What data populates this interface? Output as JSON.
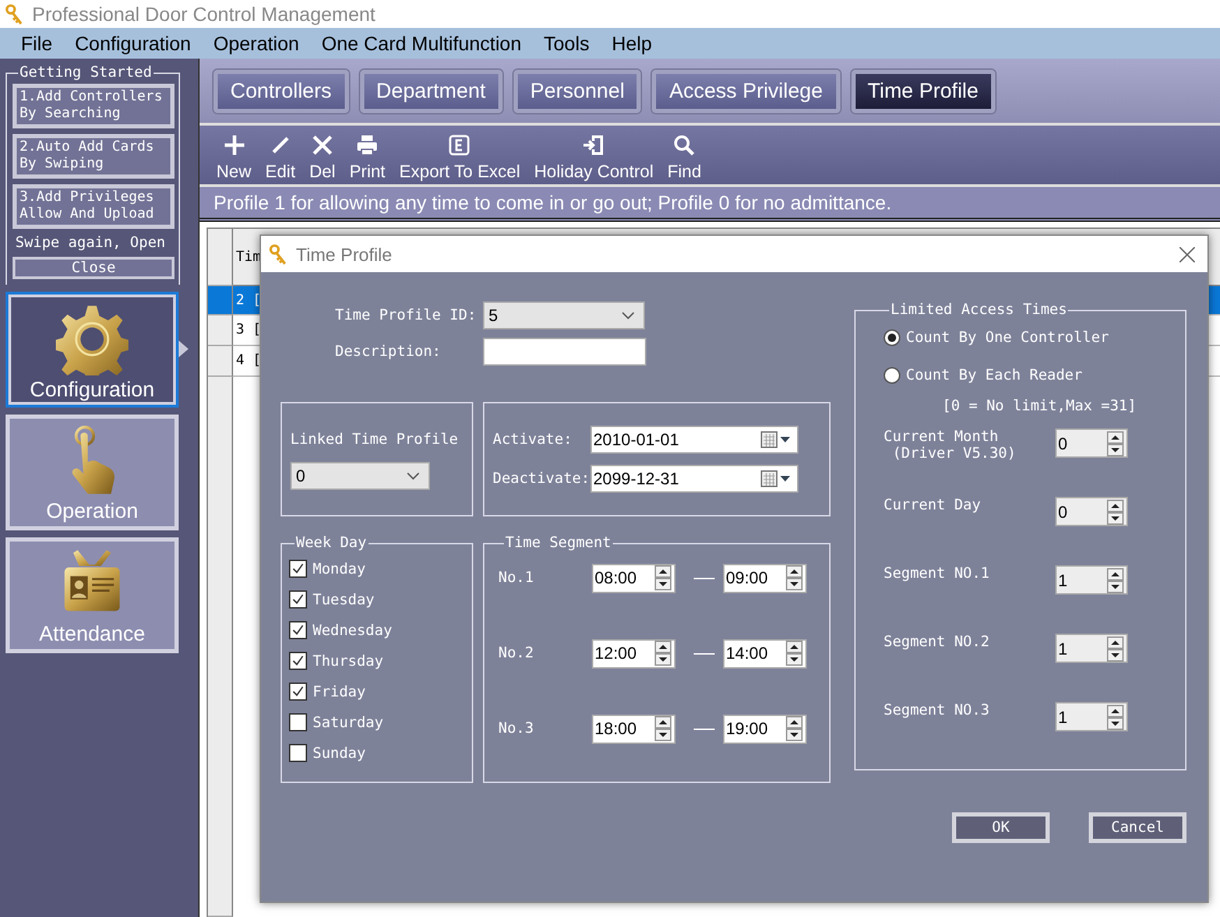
{
  "window": {
    "title": "Professional Door Control Management"
  },
  "menu": [
    "File",
    "Configuration",
    "Operation",
    "One Card Multifunction",
    "Tools",
    "Help"
  ],
  "getting_started": {
    "title": "Getting Started",
    "steps": [
      {
        "lines": [
          "1.Add Controllers",
          "By Searching"
        ]
      },
      {
        "lines": [
          "2.Auto Add Cards",
          "By Swiping"
        ]
      },
      {
        "lines": [
          "3.Add Privileges",
          "Allow And Upload"
        ]
      }
    ],
    "note": "Swipe again, Open",
    "close": "Close"
  },
  "nav": [
    {
      "label": "Configuration",
      "selected": true
    },
    {
      "label": "Operation",
      "selected": false
    },
    {
      "label": "Attendance",
      "selected": false
    }
  ],
  "tabs": [
    {
      "label": "Controllers",
      "selected": false
    },
    {
      "label": "Department",
      "selected": false
    },
    {
      "label": "Personnel",
      "selected": false
    },
    {
      "label": "Access Privilege",
      "selected": false
    },
    {
      "label": "Time Profile",
      "selected": true
    }
  ],
  "toolbar": [
    "New",
    "Edit",
    "Del",
    "Print",
    "Export To Excel",
    "Holiday Control",
    "Find"
  ],
  "info": "Profile 1 for allowing any time to come in or go out; Profile 0  for no admittance.",
  "table": {
    "column_1": "Tim",
    "rows": [
      {
        "cell": "2 [",
        "selected": true
      },
      {
        "cell": "3 [",
        "selected": false
      },
      {
        "cell": "4 [",
        "selected": false
      }
    ]
  },
  "dialog": {
    "title": "Time Profile",
    "profile_id": {
      "label": "Time Profile ID:",
      "value": "5"
    },
    "description": {
      "label": "Description:"
    },
    "linked": {
      "label": "Linked Time Profile",
      "value": "0"
    },
    "activate": {
      "label": "Activate:",
      "value": "2010-01-01"
    },
    "deactivate": {
      "label": "Deactivate:",
      "value": "2099-12-31"
    },
    "week_day": {
      "title": "Week Day",
      "days": [
        {
          "label": "Monday",
          "checked": true
        },
        {
          "label": "Tuesday",
          "checked": true
        },
        {
          "label": "Wednesday",
          "checked": true
        },
        {
          "label": "Thursday",
          "checked": true
        },
        {
          "label": "Friday",
          "checked": true
        },
        {
          "label": "Saturday",
          "checked": false
        },
        {
          "label": "Sunday",
          "checked": false
        }
      ]
    },
    "time_segment": {
      "title": "Time Segment",
      "segments": [
        {
          "label": "No.1",
          "start": "08:00",
          "end": "09:00"
        },
        {
          "label": "No.2",
          "start": "12:00",
          "end": "14:00"
        },
        {
          "label": "No.3",
          "start": "18:00",
          "end": "19:00"
        }
      ]
    },
    "limited": {
      "title": "Limited Access Times",
      "options": [
        {
          "label": "Count By One Controller",
          "selected": true
        },
        {
          "label": "Count By Each Reader",
          "selected": false
        }
      ],
      "hint": "[0 = No limit,Max =31]",
      "counters": [
        {
          "lines": [
            "Current Month",
            "(Driver V5.30)"
          ],
          "value": "0"
        },
        {
          "lines": [
            "Current Day"
          ],
          "value": "0"
        },
        {
          "lines": [
            "Segment NO.1"
          ],
          "value": "1"
        },
        {
          "lines": [
            "Segment NO.2"
          ],
          "value": "1"
        },
        {
          "lines": [
            "Segment NO.3"
          ],
          "value": "1"
        }
      ]
    },
    "buttons": [
      "OK",
      "Cancel"
    ]
  }
}
